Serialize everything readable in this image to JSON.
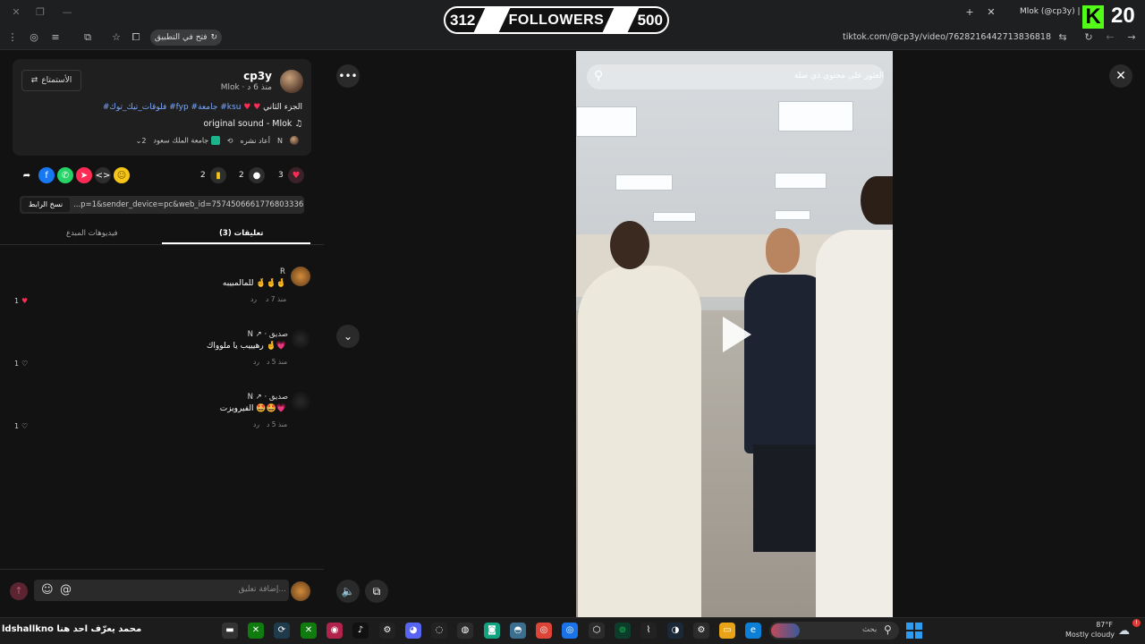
{
  "browser": {
    "tab_title": "Mlok (@cp3y) | Tik",
    "url": "tiktok.com/@cp3y/video/7628216442713836818",
    "open_app_label": "فتح في التطبيق"
  },
  "stream_overlay": {
    "followers_current": "312",
    "followers_label": "FOLLOWERS",
    "followers_goal": "500",
    "kick_logo": "K",
    "kick_count": "20"
  },
  "post": {
    "username": "cp3y",
    "subline": "Mlok · منذ 6 د",
    "follow_label": "الأستمتاع",
    "caption_text": "الجزء الثاني",
    "caption_tags": "#فلوقات_تيك_توك #fyp #جامعة #ksu",
    "sound": "original sound - Mlok",
    "reposted_label": "أعاد نشره",
    "repost_user": "N",
    "location_label": "جامعة الملك سعود",
    "count_badge": "2"
  },
  "actions": {
    "likes": "3",
    "comments": "2",
    "saves": "2"
  },
  "link": {
    "copy_label": "نسخ الرابط",
    "value": "...p=1&sender_device=pc&web_id=7574506661776803336"
  },
  "tabs": {
    "comments": "تعليقات (3)",
    "creator_videos": "فيديوهات المبدع"
  },
  "comments": [
    {
      "author": "R",
      "text": "للمالمبيبه 🤞🤞🤞",
      "time": "منذ 7 د",
      "reply": "رد",
      "likes": "1"
    },
    {
      "author": "N ↗ · صديق",
      "text": "رهيييب يا ملوواك 🤞💗",
      "time": "منذ 5 د",
      "reply": "رد",
      "likes": "1"
    },
    {
      "author": "N ↗ · صديق",
      "text": "الفيرويزت 🤩🤩💗",
      "time": "منذ 5 د",
      "reply": "رد",
      "likes": "1"
    }
  ],
  "comment_input": {
    "placeholder": "إضافة تعليق..."
  },
  "video": {
    "search_placeholder": "العثور على محتوى ذي صلة"
  },
  "taskbar": {
    "left_text": "ldshallkno محمد يعرّف احد هنا",
    "search_label": "بحث",
    "weather_temp": "87°F",
    "weather_desc": "Mostly cloudy"
  },
  "colors": {
    "accent_like": "#fe2c55",
    "kick_green": "#53fc18",
    "link_blue": "#7aa9ff"
  }
}
